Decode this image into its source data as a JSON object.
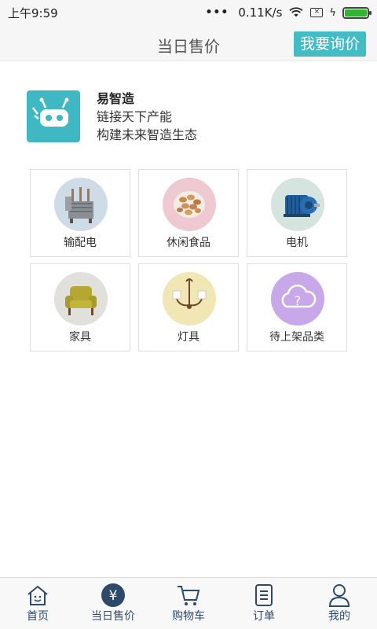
{
  "status": {
    "time": "上午9:59",
    "network_speed": "0.11K/s",
    "dots": "•••"
  },
  "header": {
    "title": "当日售价",
    "inquire_button": "我要询价"
  },
  "brand": {
    "name": "易智造",
    "slogan_1": "链接天下产能",
    "slogan_2": "构建未来智造生态"
  },
  "categories": [
    {
      "label": "输配电",
      "icon": "transformer-image"
    },
    {
      "label": "休闲食品",
      "icon": "snack-food-image"
    },
    {
      "label": "电机",
      "icon": "electric-motor-image"
    },
    {
      "label": "家具",
      "icon": "armchair-image"
    },
    {
      "label": "灯具",
      "icon": "wall-lamp-image"
    },
    {
      "label": "待上架品类",
      "icon": "cloud-question-icon"
    }
  ],
  "nav": {
    "items": [
      {
        "label": "首页",
        "icon": "home-icon"
      },
      {
        "label": "当日售价",
        "icon": "yen-icon",
        "active": true
      },
      {
        "label": "购物车",
        "icon": "cart-icon"
      },
      {
        "label": "订单",
        "icon": "order-list-icon"
      },
      {
        "label": "我的",
        "icon": "user-icon"
      }
    ]
  },
  "colors": {
    "accent": "#44bcc6",
    "nav_text": "#2e4a6a"
  }
}
